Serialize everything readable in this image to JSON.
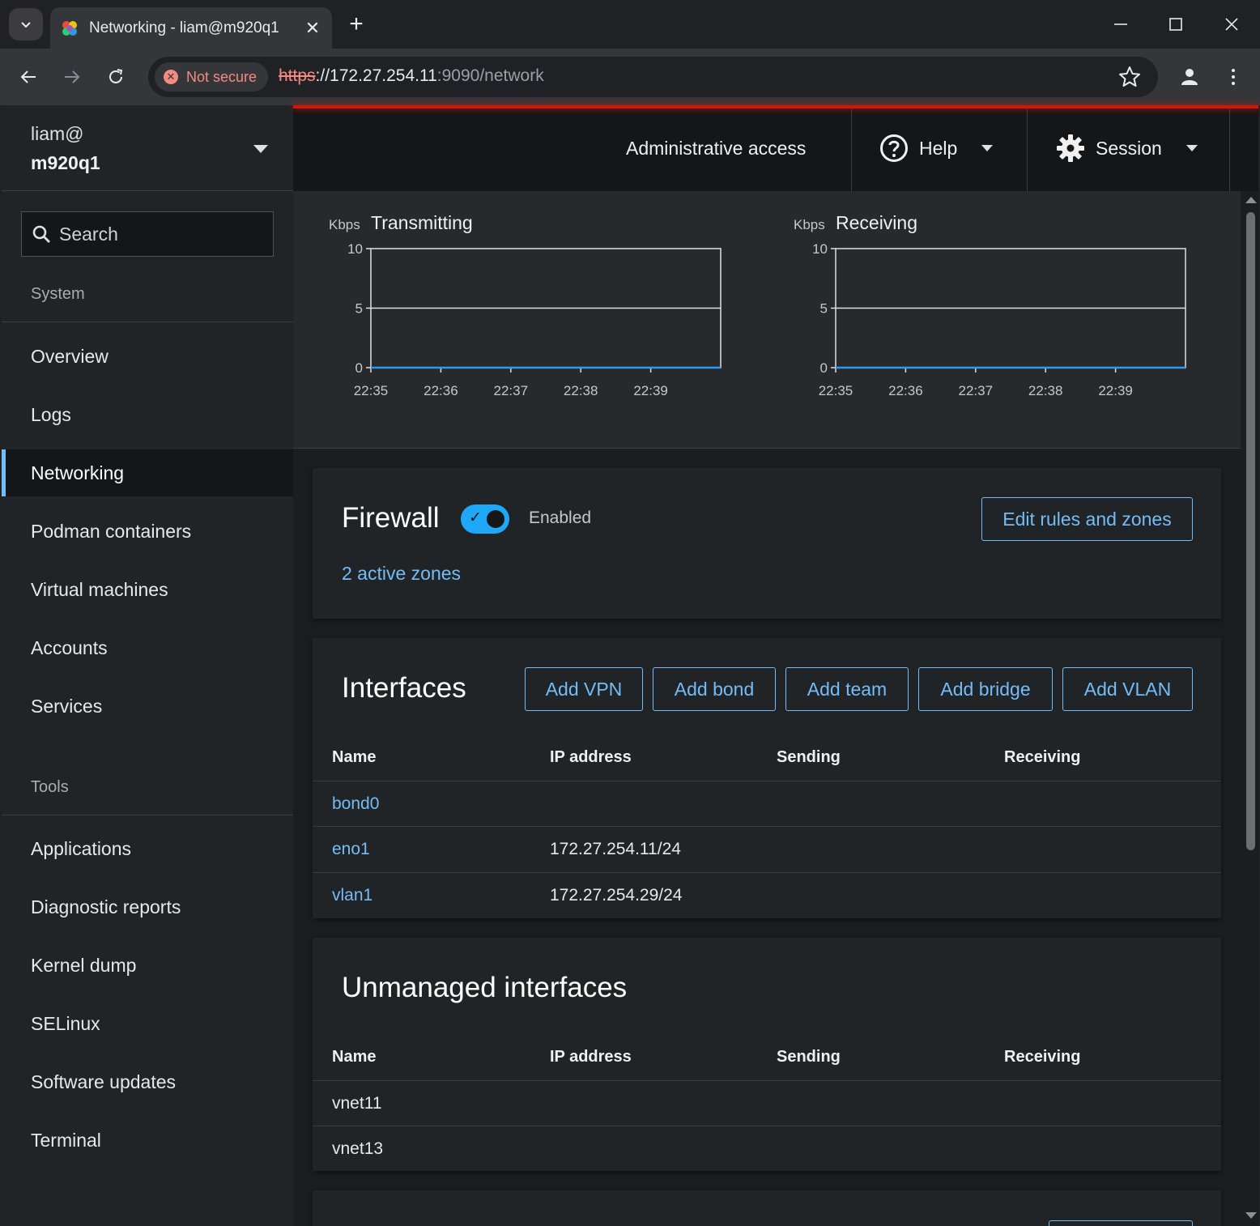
{
  "browser": {
    "tab_title": "Networking - liam@m920q1",
    "security_label": "Not secure",
    "url_scheme": "https",
    "url_host": "://172.27.254.11",
    "url_path": ":9090/network"
  },
  "host": {
    "user": "liam@",
    "name": "m920q1"
  },
  "sidebar": {
    "search_label": "Search",
    "system_heading": "System",
    "system_items": [
      "Overview",
      "Logs",
      "Networking",
      "Podman containers",
      "Virtual machines",
      "Accounts",
      "Services"
    ],
    "active_item": "Networking",
    "tools_heading": "Tools",
    "tools_items": [
      "Applications",
      "Diagnostic reports",
      "Kernel dump",
      "SELinux",
      "Software updates",
      "Terminal"
    ]
  },
  "masthead": {
    "admin_access": "Administrative access",
    "help": "Help",
    "session": "Session"
  },
  "graphs": {
    "unit": "Kbps",
    "transmitting_title": "Transmitting",
    "receiving_title": "Receiving",
    "y_ticks": [
      "10",
      "5",
      "0"
    ],
    "x_ticks": [
      "22:35",
      "22:36",
      "22:37",
      "22:38",
      "22:39"
    ]
  },
  "chart_data": [
    {
      "type": "line",
      "title": "Transmitting",
      "ylabel": "Kbps",
      "x": [
        "22:35",
        "22:36",
        "22:37",
        "22:38",
        "22:39"
      ],
      "series": [
        {
          "values": [
            0,
            0,
            0,
            0,
            0
          ]
        }
      ],
      "ylim": [
        0,
        10
      ],
      "grid": true
    },
    {
      "type": "line",
      "title": "Receiving",
      "ylabel": "Kbps",
      "x": [
        "22:35",
        "22:36",
        "22:37",
        "22:38",
        "22:39"
      ],
      "series": [
        {
          "values": [
            0,
            0,
            0,
            0,
            0
          ]
        }
      ],
      "ylim": [
        0,
        10
      ],
      "grid": true
    }
  ],
  "firewall": {
    "title": "Firewall",
    "enabled": true,
    "status": "Enabled",
    "edit_button": "Edit rules and zones",
    "zones_link": "2 active zones"
  },
  "interfaces": {
    "title": "Interfaces",
    "buttons": [
      "Add VPN",
      "Add bond",
      "Add team",
      "Add bridge",
      "Add VLAN"
    ],
    "columns": [
      "Name",
      "IP address",
      "Sending",
      "Receiving"
    ],
    "rows": [
      {
        "name": "bond0",
        "ip": "",
        "sending": "",
        "receiving": ""
      },
      {
        "name": "eno1",
        "ip": "172.27.254.11/24",
        "sending": "",
        "receiving": ""
      },
      {
        "name": "vlan1",
        "ip": "172.27.254.29/24",
        "sending": "",
        "receiving": ""
      }
    ]
  },
  "unmanaged": {
    "title": "Unmanaged interfaces",
    "columns": [
      "Name",
      "IP address",
      "Sending",
      "Receiving"
    ],
    "rows": [
      {
        "name": "vnet11",
        "ip": "",
        "sending": "",
        "receiving": ""
      },
      {
        "name": "vnet13",
        "ip": "",
        "sending": "",
        "receiving": ""
      }
    ]
  },
  "colors": {
    "accent": "#73bcf7",
    "toggle_on": "#1fa7f8",
    "danger_bar": "#c9190b",
    "not_secure": "#f28b82"
  }
}
